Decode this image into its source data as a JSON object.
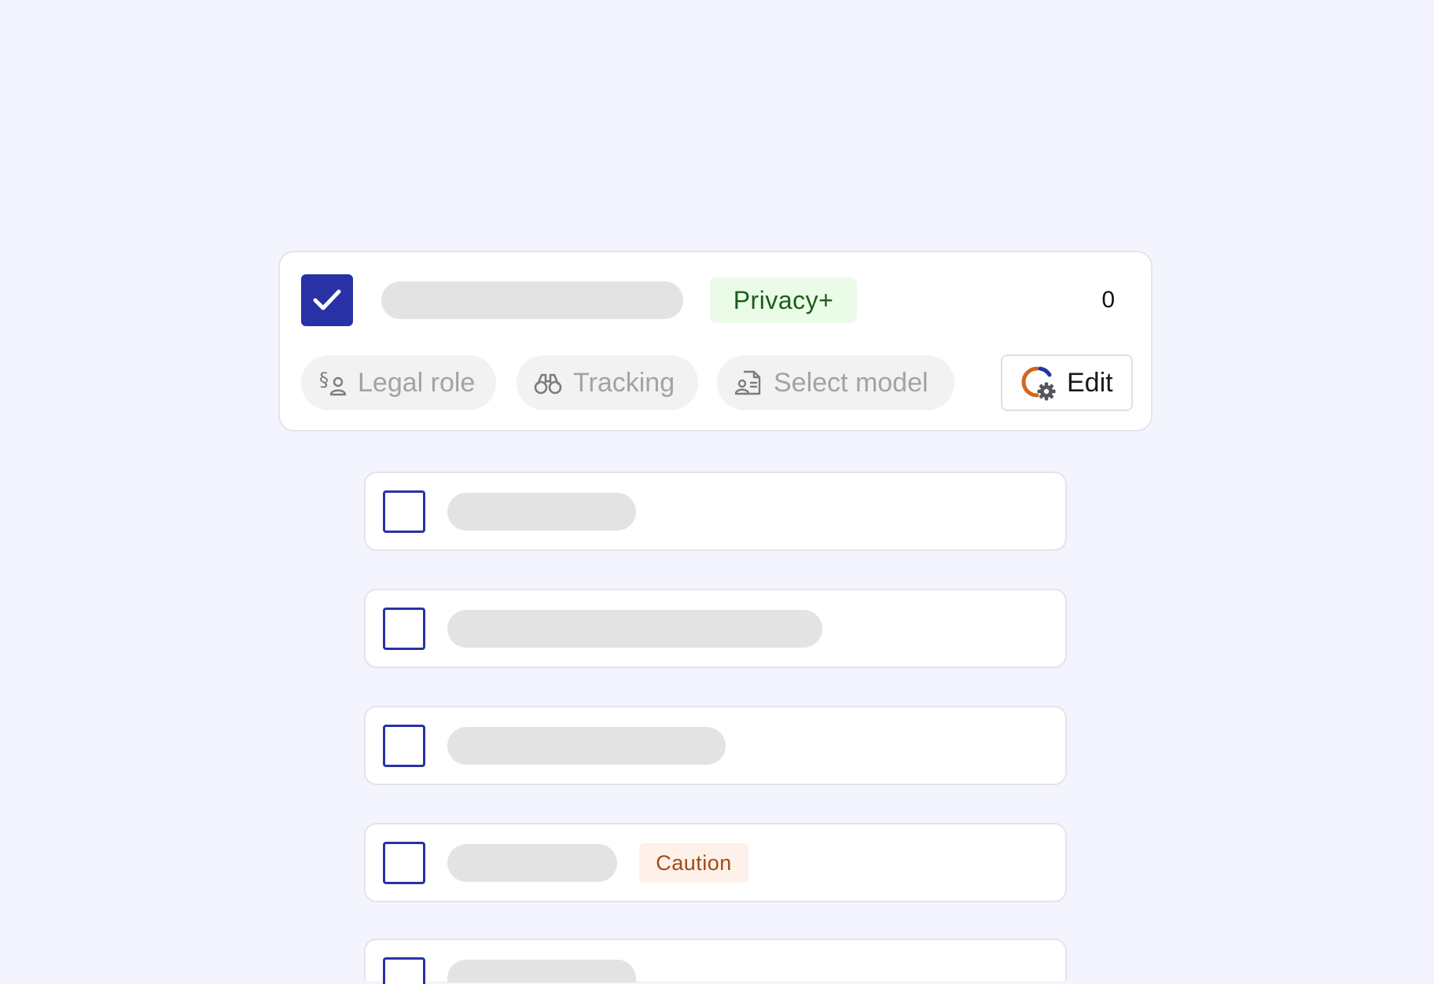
{
  "main_card": {
    "checked": true,
    "badge_label": "Privacy+",
    "count": "0",
    "chips": [
      {
        "label": "Legal role",
        "icon": "legal-role-icon"
      },
      {
        "label": "Tracking",
        "icon": "binoculars-icon"
      },
      {
        "label": "Select model",
        "icon": "document-user-icon"
      }
    ],
    "edit_label": "Edit",
    "edit_icon": "settings-progress-icon"
  },
  "rows": [
    {
      "checked": false
    },
    {
      "checked": false
    },
    {
      "checked": false
    },
    {
      "checked": false,
      "badge_label": "Caution"
    },
    {
      "checked": false
    }
  ],
  "colors": {
    "accent": "#2832a5",
    "background": "#f3f4fd",
    "privacy_badge_bg": "#eafbe7",
    "privacy_badge_text": "#1c5d1c",
    "caution_badge_bg": "#fdf1ea",
    "caution_badge_text": "#a34a14",
    "skeleton": "#e3e3e3",
    "edit_icon_orange": "#d4671c"
  }
}
